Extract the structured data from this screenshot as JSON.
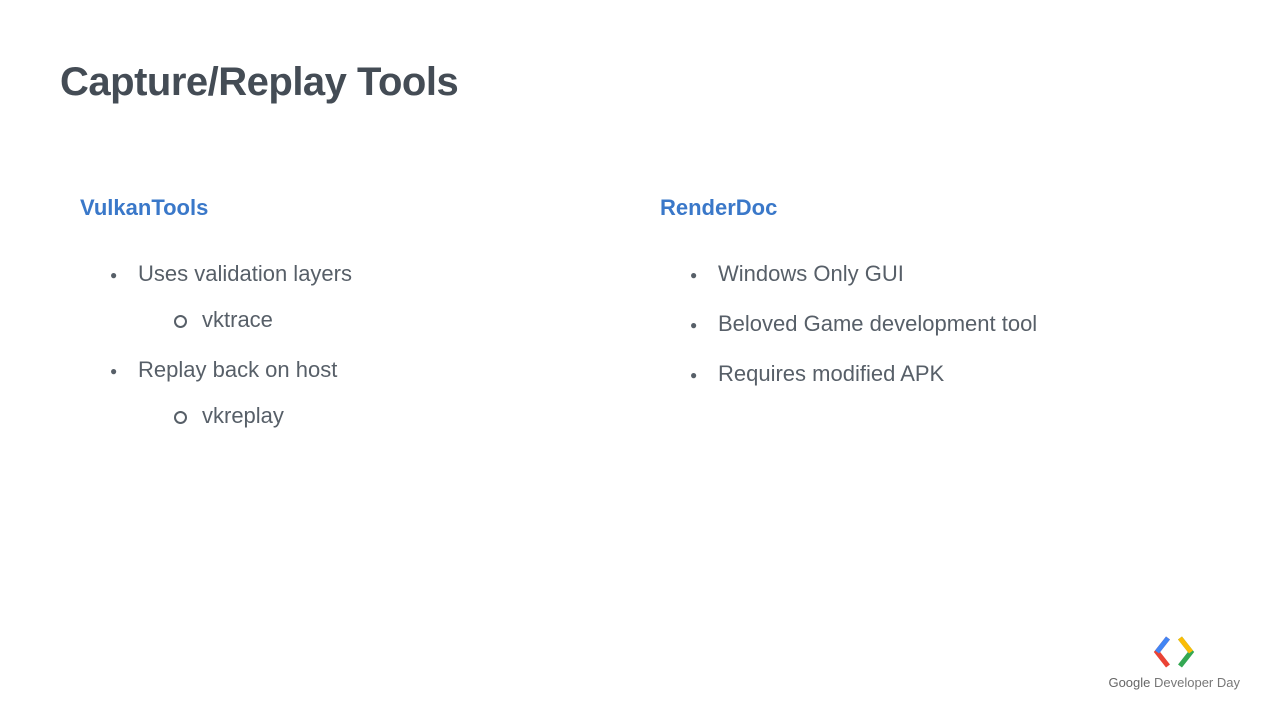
{
  "title": "Capture/Replay Tools",
  "left": {
    "heading": "VulkanTools",
    "items": [
      {
        "text": "Uses validation layers",
        "sub": [
          "vktrace"
        ]
      },
      {
        "text": "Replay back on host",
        "sub": [
          "vkreplay"
        ]
      }
    ]
  },
  "right": {
    "heading": "RenderDoc",
    "items": [
      {
        "text": "Windows Only GUI"
      },
      {
        "text": "Beloved Game development tool"
      },
      {
        "text": "Requires modified APK"
      }
    ]
  },
  "footer": {
    "brand": "Google",
    "rest": " Developer Day"
  }
}
